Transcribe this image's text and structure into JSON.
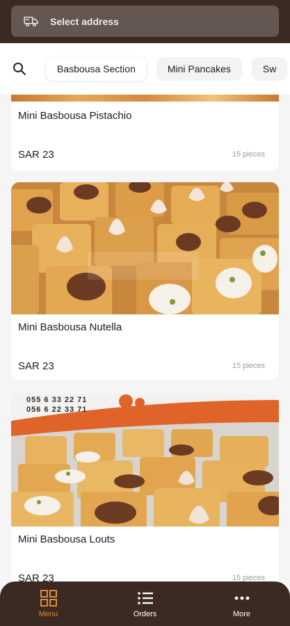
{
  "header": {
    "address_placeholder": "Select address",
    "icon": "delivery-truck-icon"
  },
  "category_tabs": {
    "search_icon": "search-icon",
    "items": [
      {
        "label": "Basbousa Section",
        "active": true
      },
      {
        "label": "Mini Pancakes",
        "active": false
      },
      {
        "label": "Sw",
        "active": false
      }
    ]
  },
  "products": [
    {
      "name": "Mini Basbousa Pistachio",
      "price": "SAR 23",
      "quantity": "15 pieces"
    },
    {
      "name": "Mini Basbousa Nutella",
      "price": "SAR 23",
      "quantity": "15 pieces"
    },
    {
      "name": "Mini Basbousa Louts",
      "price": "SAR 23",
      "quantity": "15 pieces",
      "photo_text": [
        "055 6 33 22 71",
        "056 6 22 33 71"
      ]
    }
  ],
  "bottom_nav": {
    "items": [
      {
        "label": "Menu",
        "icon": "grid-icon",
        "active": true
      },
      {
        "label": "Orders",
        "icon": "list-icon",
        "active": false
      },
      {
        "label": "More",
        "icon": "more-dots-icon",
        "active": false
      }
    ]
  },
  "colors": {
    "header_bg": "#3b2a22",
    "accent": "#e08a3c",
    "address_bar_bg": "#645651"
  }
}
